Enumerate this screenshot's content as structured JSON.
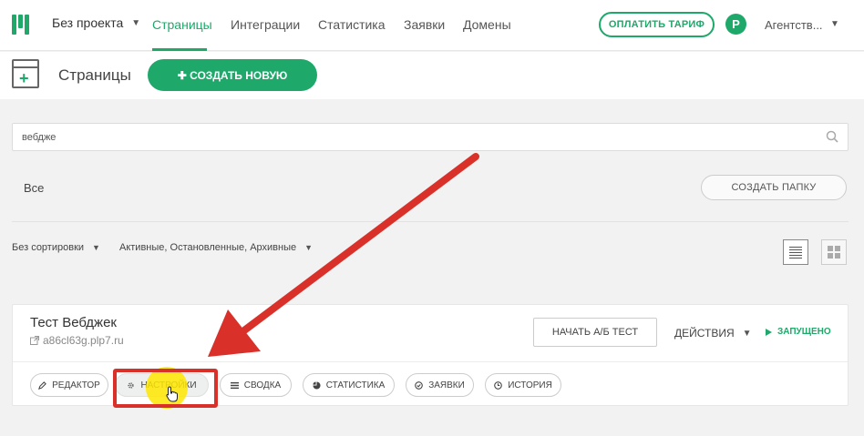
{
  "nav": {
    "project": "Без проекта",
    "items": [
      "Страницы",
      "Интеграции",
      "Статистика",
      "Заявки",
      "Домены"
    ],
    "pay_button": "ОПЛАТИТЬ ТАРИФ",
    "avatar_letter": "P",
    "account": "Агентств..."
  },
  "header": {
    "title": "Страницы",
    "create_button": "✚ СОЗДАТЬ НОВУЮ"
  },
  "search": {
    "value": "вебдже"
  },
  "folders": {
    "current": "Все",
    "create_folder_button": "СОЗДАТЬ ПАПКУ"
  },
  "filters": {
    "sort": "Без сортировки",
    "status_filter": "Активные, Остановленные, Архивные"
  },
  "card": {
    "title": "Тест Вебджек",
    "domain": "a86cl63g.plp7.ru",
    "ab_button": "НАЧАТЬ А/Б ТЕСТ",
    "actions": "ДЕЙСТВИЯ",
    "status": "ЗАПУЩЕНО",
    "tabs": [
      "РЕДАКТОР",
      "НАСТРОЙКИ",
      "СВОДКА",
      "СТАТИСТИКА",
      "ЗАЯВКИ",
      "ИСТОРИЯ"
    ]
  },
  "colors": {
    "accent": "#1ea86a",
    "annotation": "#d9302a",
    "highlight": "#ffe600"
  },
  "icons": [
    "logo-icon",
    "page-add-icon",
    "search-icon",
    "list-view-icon",
    "grid-view-icon",
    "external-link-icon",
    "play-icon",
    "pencil-icon",
    "gear-icon",
    "list-icon",
    "pie-chart-icon",
    "check-circle-icon",
    "clock-icon",
    "hand-pointer-icon"
  ]
}
